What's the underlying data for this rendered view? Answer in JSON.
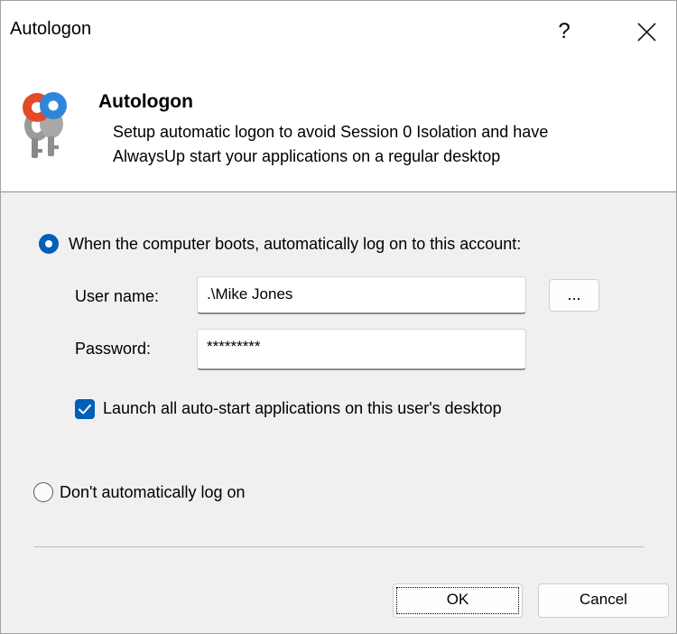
{
  "window": {
    "title": "Autologon",
    "help_label": "?",
    "close_icon": "close-icon"
  },
  "header": {
    "icon": "keys-icon",
    "title": "Autologon",
    "line1": "Setup automatic logon to avoid Session 0 Isolation and have",
    "line2": "AlwaysUp start your applications on a regular desktop"
  },
  "options": {
    "auto_logon_label": "When the computer boots, automatically log on to this account:",
    "auto_logon_selected": true,
    "no_logon_label": "Don't automatically log on",
    "no_logon_selected": false
  },
  "form": {
    "username_label": "User name:",
    "username_value": ".\\Mike Jones",
    "browse_label": "...",
    "password_label": "Password:",
    "password_value": "*********",
    "launch_label": "Launch all auto-start applications on this user's desktop",
    "launch_checked": true
  },
  "buttons": {
    "ok": "OK",
    "cancel": "Cancel"
  },
  "colors": {
    "accent": "#005fb8",
    "header_background": "#ffffff",
    "body_background": "#f0f0f0"
  }
}
